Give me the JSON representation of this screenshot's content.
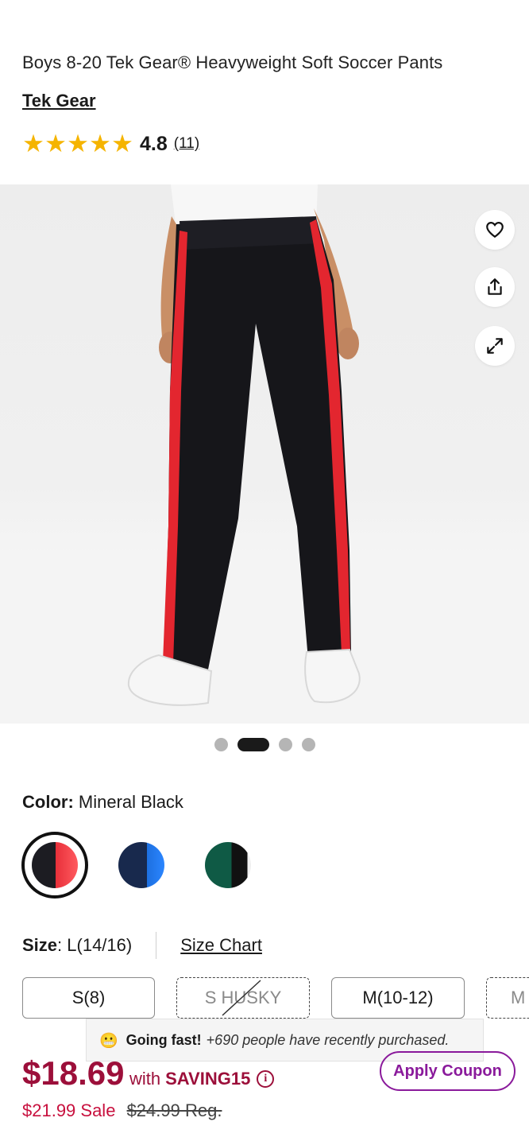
{
  "product": {
    "title": "Boys 8-20 Tek Gear® Heavyweight Soft Soccer Pants",
    "brand": "Tek Gear",
    "rating_value": "4.8",
    "review_count": "(11)",
    "stars": 4.8
  },
  "gallery": {
    "image_alt": "Boys soccer pants, back view",
    "slide_count": 4,
    "active_slide": 2
  },
  "actions": {
    "wishlist_icon": "heart-icon",
    "share_icon": "share-icon",
    "expand_icon": "expand-icon"
  },
  "color": {
    "label": "Color:",
    "selected": "Mineral Black",
    "options": [
      {
        "name": "Mineral Black",
        "main": "#1c1c22",
        "stripe": "#e8303a"
      },
      {
        "name": "Navy",
        "main": "#18294d",
        "stripe": "#1d6fe0"
      },
      {
        "name": "Green",
        "main": "#0f5a45",
        "stripe": "#111111"
      }
    ]
  },
  "size": {
    "label": "Size",
    "selected": "L(14/16)",
    "chart_link": "Size Chart",
    "options": [
      {
        "label": "S(8)",
        "available": true
      },
      {
        "label": "S HUSKY",
        "available": false
      },
      {
        "label": "M(10-12)",
        "available": true
      },
      {
        "label": "M",
        "available": false
      }
    ]
  },
  "toast": {
    "emoji": "😬",
    "headline": "Going fast!",
    "detail": "+690 people have recently purchased."
  },
  "pricing": {
    "coupon_price": "$18.69",
    "with_text": "with",
    "coupon_code": "SAVING15",
    "info_icon": "info-icon",
    "apply_label": "Apply Coupon",
    "sale_text": "$21.99 Sale",
    "regular_text": "$24.99 Reg.",
    "accent": "#9c0f3a",
    "coupon_button_color": "#8a1a9b"
  }
}
